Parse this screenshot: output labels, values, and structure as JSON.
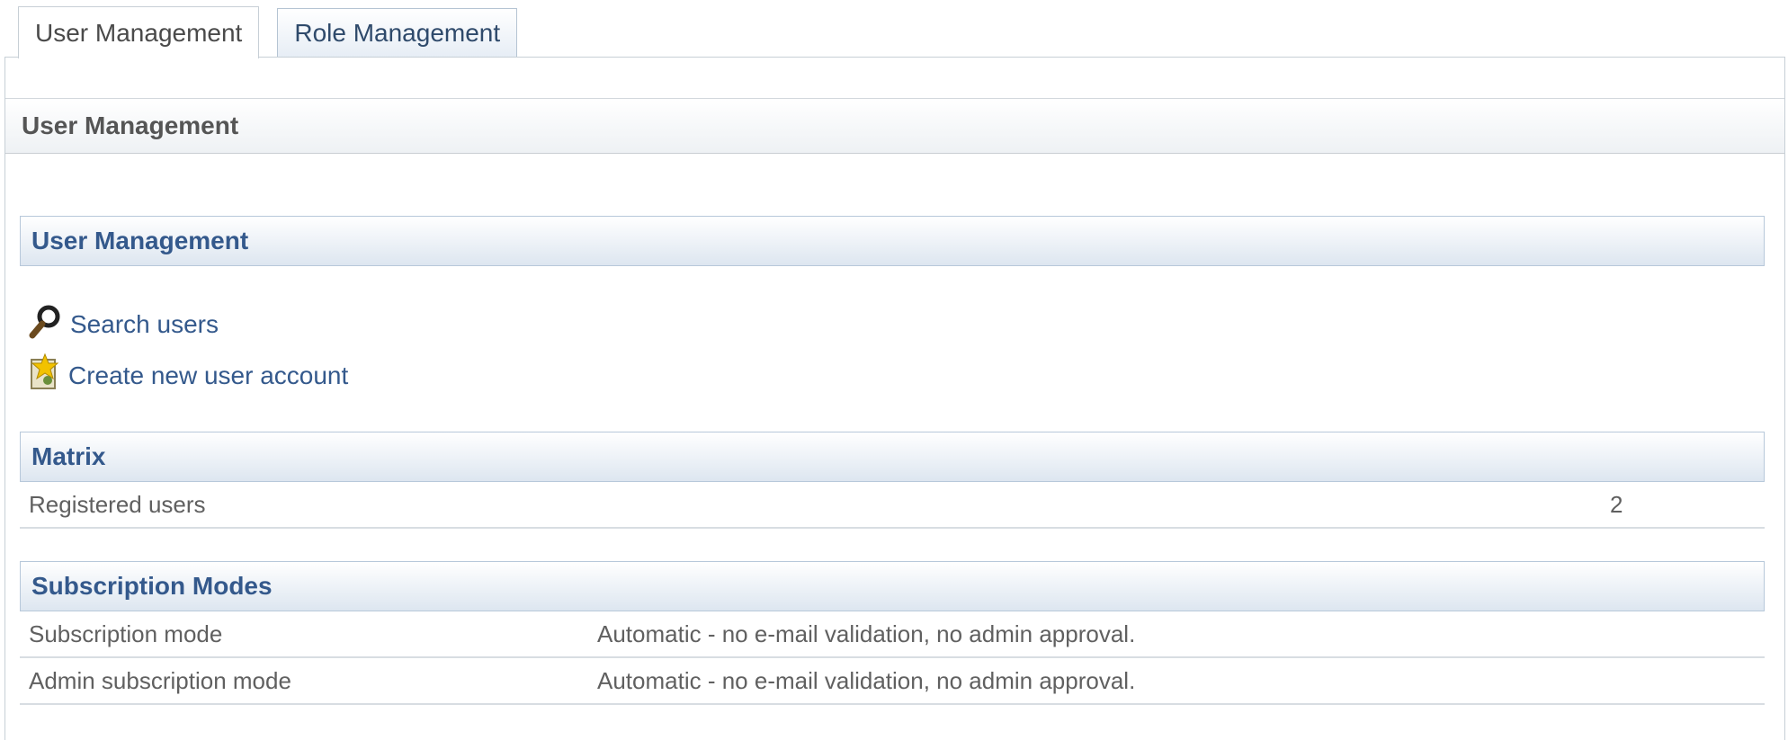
{
  "tabs": [
    {
      "label": "User Management",
      "active": true
    },
    {
      "label": "Role Management",
      "active": false
    }
  ],
  "panel_header": {
    "title": "User Management"
  },
  "user_section": {
    "title": "User Management",
    "links": [
      {
        "label": "Search users",
        "icon": "search-icon"
      },
      {
        "label": "Create new user account",
        "icon": "new-user-icon"
      }
    ]
  },
  "matrix": {
    "title": "Matrix",
    "rows": [
      {
        "label": "Registered users",
        "value": "2"
      }
    ]
  },
  "subscription": {
    "title": "Subscription Modes",
    "rows": [
      {
        "label": "Subscription mode",
        "value": "Automatic - no e-mail validation, no admin approval."
      },
      {
        "label": "Admin subscription mode",
        "value": "Automatic - no e-mail validation, no admin approval."
      }
    ]
  },
  "colors": {
    "link": "#34598c",
    "section_gradient_end": "#dde6f0",
    "border": "#b7c8da"
  }
}
